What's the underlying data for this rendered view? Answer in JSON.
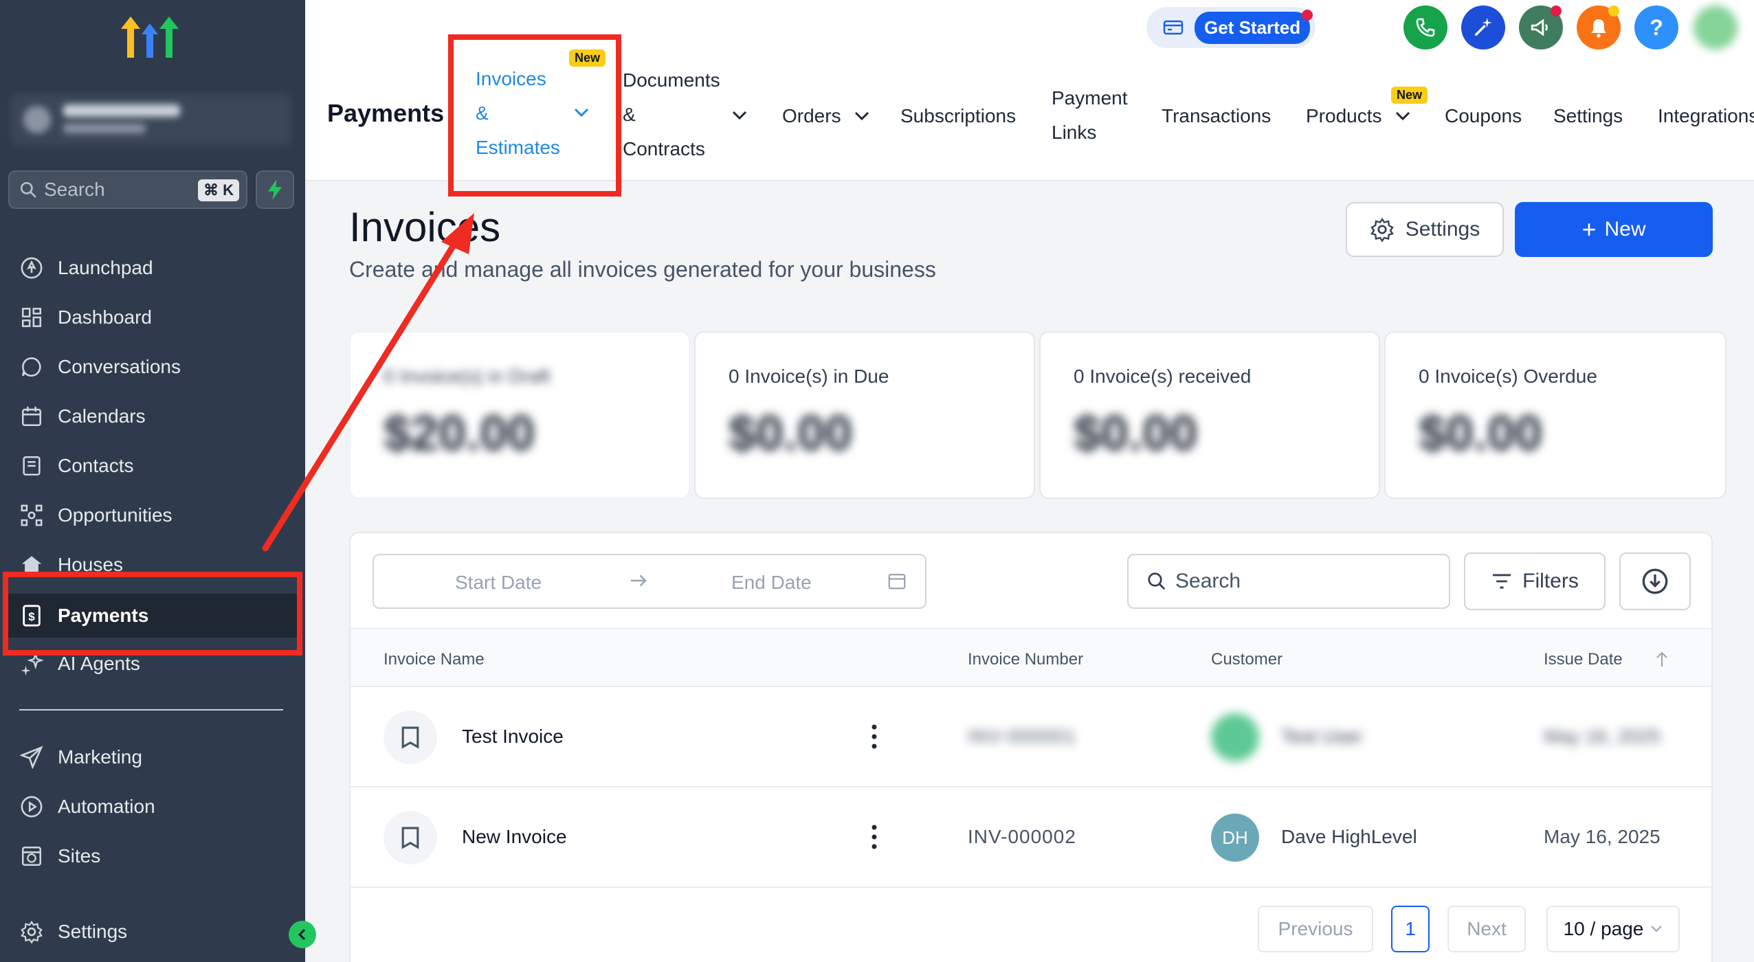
{
  "sidebar": {
    "search_placeholder": "Search",
    "search_shortcut": "⌘ K",
    "items": [
      {
        "label": "Launchpad",
        "icon": "rocket-icon"
      },
      {
        "label": "Dashboard",
        "icon": "grid-icon"
      },
      {
        "label": "Conversations",
        "icon": "chat-icon"
      },
      {
        "label": "Calendars",
        "icon": "calendar-icon"
      },
      {
        "label": "Contacts",
        "icon": "contacts-icon"
      },
      {
        "label": "Opportunities",
        "icon": "network-icon"
      },
      {
        "label": "Houses",
        "icon": "house-icon"
      },
      {
        "label": "Payments",
        "icon": "receipt-icon",
        "active": true
      },
      {
        "label": "AI Agents",
        "icon": "sparkle-icon"
      },
      {
        "label": "Marketing",
        "icon": "send-icon"
      },
      {
        "label": "Automation",
        "icon": "automation-icon"
      },
      {
        "label": "Sites",
        "icon": "globe-icon"
      },
      {
        "label": "Settings",
        "icon": "gear-icon"
      }
    ]
  },
  "topnav": {
    "module": "Payments",
    "tabs": {
      "invoices": [
        "Invoices",
        "&",
        "Estimates"
      ],
      "documents": [
        "Documents",
        "&",
        "Contracts"
      ],
      "orders": "Orders",
      "subscriptions": "Subscriptions",
      "payment_links": [
        "Payment",
        "Links"
      ],
      "transactions": "Transactions",
      "products": "Products",
      "coupons": "Coupons",
      "settings": "Settings",
      "integrations": "Integrations"
    },
    "badge_new": "New",
    "get_started": "Get Started",
    "help": "?"
  },
  "page": {
    "title": "Invoices",
    "subtitle": "Create and manage all invoices generated for your business",
    "settings_label": "Settings",
    "new_label": "New"
  },
  "cards": [
    {
      "label": "0 Invoice(s) in Draft",
      "amount": "$20.00"
    },
    {
      "label": "0 Invoice(s) in Due",
      "amount": "$0.00"
    },
    {
      "label": "0 Invoice(s) received",
      "amount": "$0.00"
    },
    {
      "label": "0 Invoice(s) Overdue",
      "amount": "$0.00"
    }
  ],
  "table": {
    "start_date": "Start Date",
    "end_date": "End Date",
    "search_placeholder": "Search",
    "filters_label": "Filters",
    "columns": [
      "Invoice Name",
      "Invoice Number",
      "Customer",
      "Issue Date"
    ],
    "rows": [
      {
        "name": "Test Invoice",
        "number": "INV-000001",
        "customer": "Test User",
        "initials": "",
        "date": "May 16, 2025"
      },
      {
        "name": "New Invoice",
        "number": "INV-000002",
        "customer": "Dave HighLevel",
        "initials": "DH",
        "date": "May 16, 2025"
      }
    ],
    "pagination": {
      "previous": "Previous",
      "page": "1",
      "next": "Next",
      "per_page": "10 / page"
    }
  },
  "colors": {
    "accent": "#155eef",
    "active_tab": "#1e88e5",
    "sidebar": "#2f3b4c",
    "annotation": "#ef2b22"
  }
}
